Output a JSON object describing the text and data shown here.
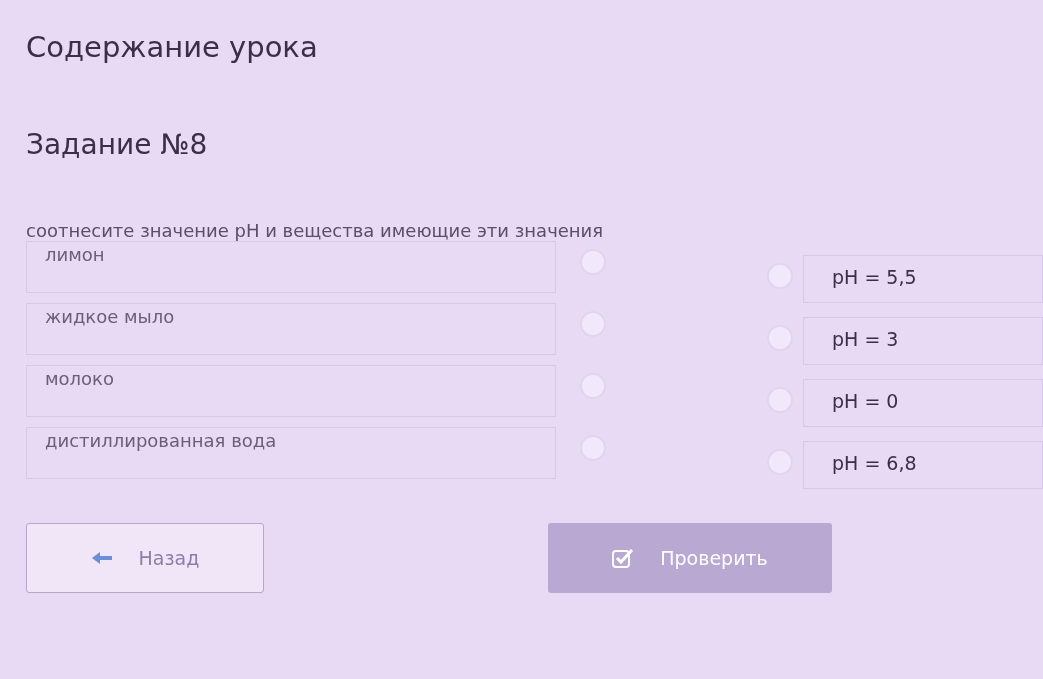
{
  "lesson_title": "Содержание урока",
  "task_title": "Задание №8",
  "instruction": "соотнесите значение pH и вещества имеющие эти значения",
  "left_items": [
    {
      "label": "лимон"
    },
    {
      "label": "жидкое мыло"
    },
    {
      "label": "молоко"
    },
    {
      "label": "дистиллированная вода"
    }
  ],
  "right_items": [
    {
      "label": "pH = 5,5"
    },
    {
      "label": "pH = 3"
    },
    {
      "label": "pH = 0"
    },
    {
      "label": "pH = 6,8"
    }
  ],
  "buttons": [
    {
      "kind": "back",
      "label": "Назад",
      "disabled": false
    },
    {
      "kind": "check",
      "label": "Проверить",
      "disabled": true
    }
  ]
}
